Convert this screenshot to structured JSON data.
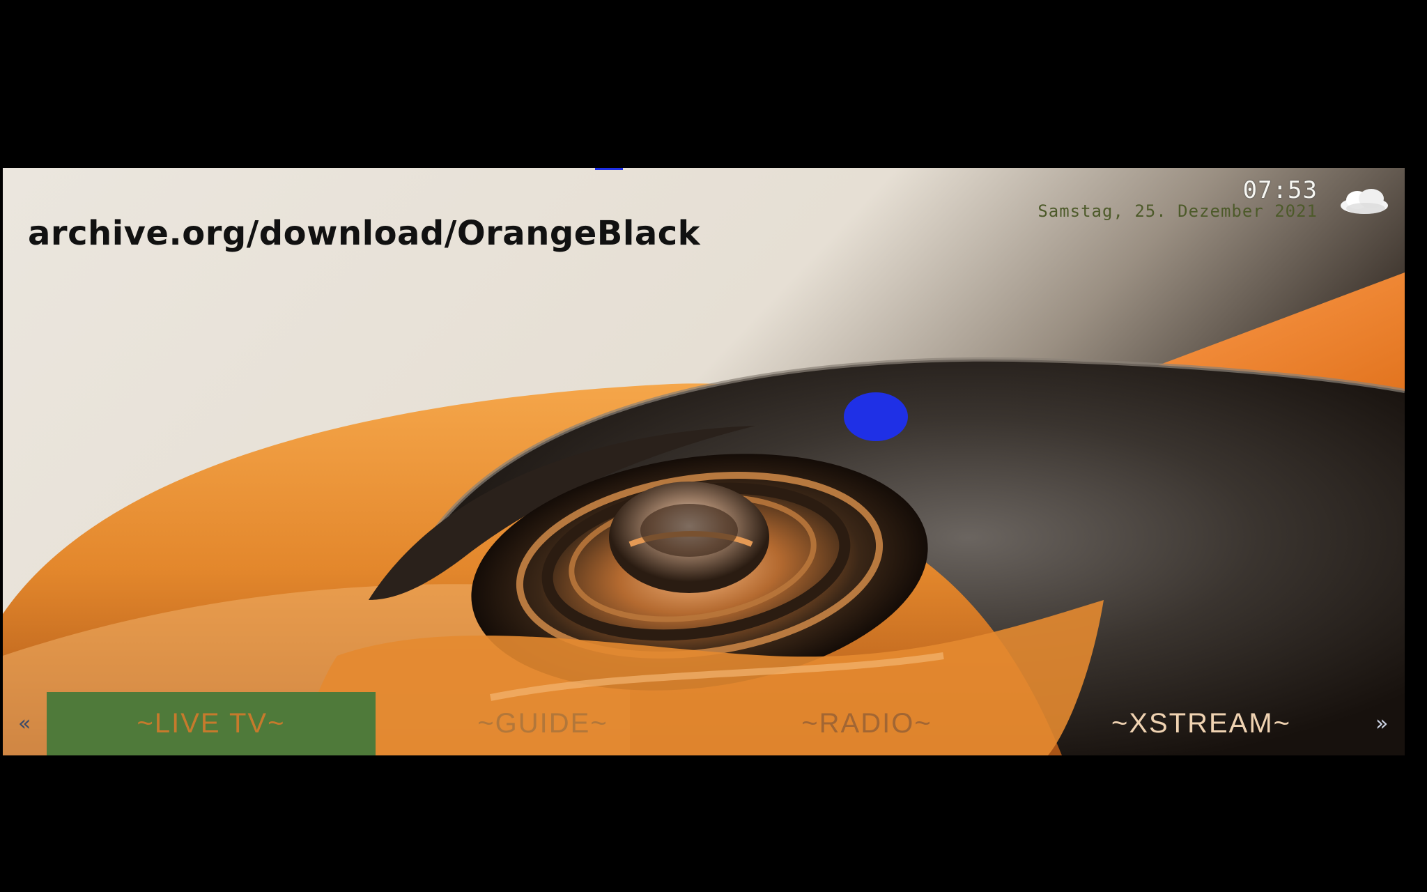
{
  "overlay": {
    "url_text": "archive.org/download/OrangeBlack"
  },
  "status": {
    "time": "07:53",
    "date": "Samstag, 25. Dezember 2021",
    "weather_icon": "cloud-icon"
  },
  "menu": {
    "items": [
      {
        "label": "~LIVE TV~",
        "selected": true
      },
      {
        "label": "~GUIDE~",
        "selected": false
      },
      {
        "label": "~RADIO~",
        "selected": false
      },
      {
        "label": "~XSTREAM~",
        "selected": false
      }
    ],
    "left_arrow": "«",
    "right_arrow": "»"
  },
  "colors": {
    "selection": "#4f7a3a",
    "orange": "#e98a2c",
    "cursor": "#1f30e6"
  }
}
